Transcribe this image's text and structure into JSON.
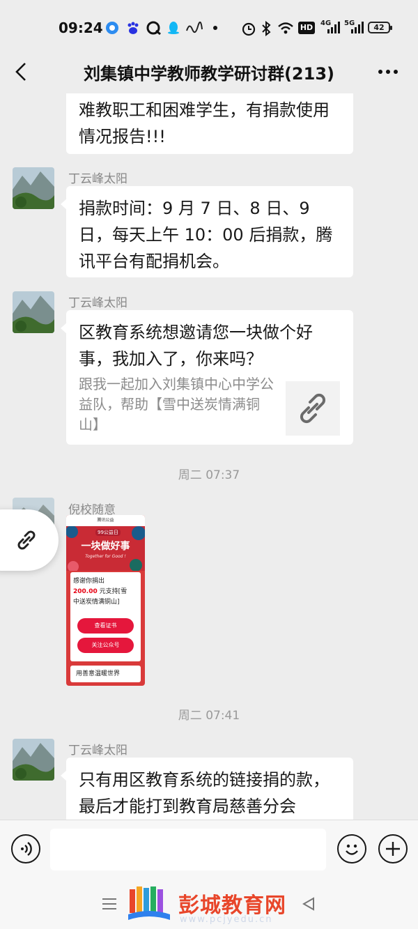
{
  "status_bar": {
    "time": "09:24",
    "battery": "42",
    "icons": [
      "browser-icon",
      "baidu-icon",
      "q-icon",
      "qq-icon",
      "handwriting-icon",
      "dot-icon",
      "alarm-icon",
      "bluetooth-icon",
      "wifi-icon",
      "hd-icon",
      "signal-4g-icon",
      "signal-5g-icon",
      "battery-icon"
    ],
    "hd_label": "HD",
    "net_4g": "4G",
    "net_5g": "5G"
  },
  "nav": {
    "title": "刘集镇中学教师教学研讨群(213)"
  },
  "messages": [
    {
      "text": "难教职工和困难学生，有捐款使用情况报告!!!"
    },
    {
      "sender": "丁云峰太阳",
      "text": "捐款时间：9 月 7 日、8 日、9 日，每天上午 10：00 后捐款，腾讯平台有配捐机会。"
    },
    {
      "sender": "丁云峰太阳",
      "link_title": "区教育系统想邀请您一块做个好事，我加入了，你来吗？",
      "link_desc": "跟我一起加入刘集镇中心中学公益队，帮助【雪中送炭情满铜山】"
    },
    {
      "timestamp": "周二 07:37"
    },
    {
      "sender": "倪校随意",
      "card": {
        "header": "腾讯公益",
        "badge": "99公益日",
        "headline": "一块做好事",
        "tagline": "Together for Good !",
        "thanks_line1": "感谢你捐出",
        "amount": "200.00",
        "amount_suffix": " 元支持[雪",
        "thanks_line3": "中送炭情满铜山]",
        "button1": "查看证书",
        "button2": "关注公众号",
        "footer": "用善意温暖世界"
      }
    },
    {
      "timestamp": "周二 07:41"
    },
    {
      "sender": "丁云峰太阳",
      "text": "只有用区教育系统的链接捐的款，最后才能打到教育局慈善分会"
    }
  ],
  "watermark": {
    "name": "彭城教育网",
    "url": "www.pcjyedu.cn"
  },
  "colors": {
    "background": "#ededed",
    "bubble": "#ffffff",
    "watermark": "#e8462a",
    "card_red": "#d93a3a"
  }
}
